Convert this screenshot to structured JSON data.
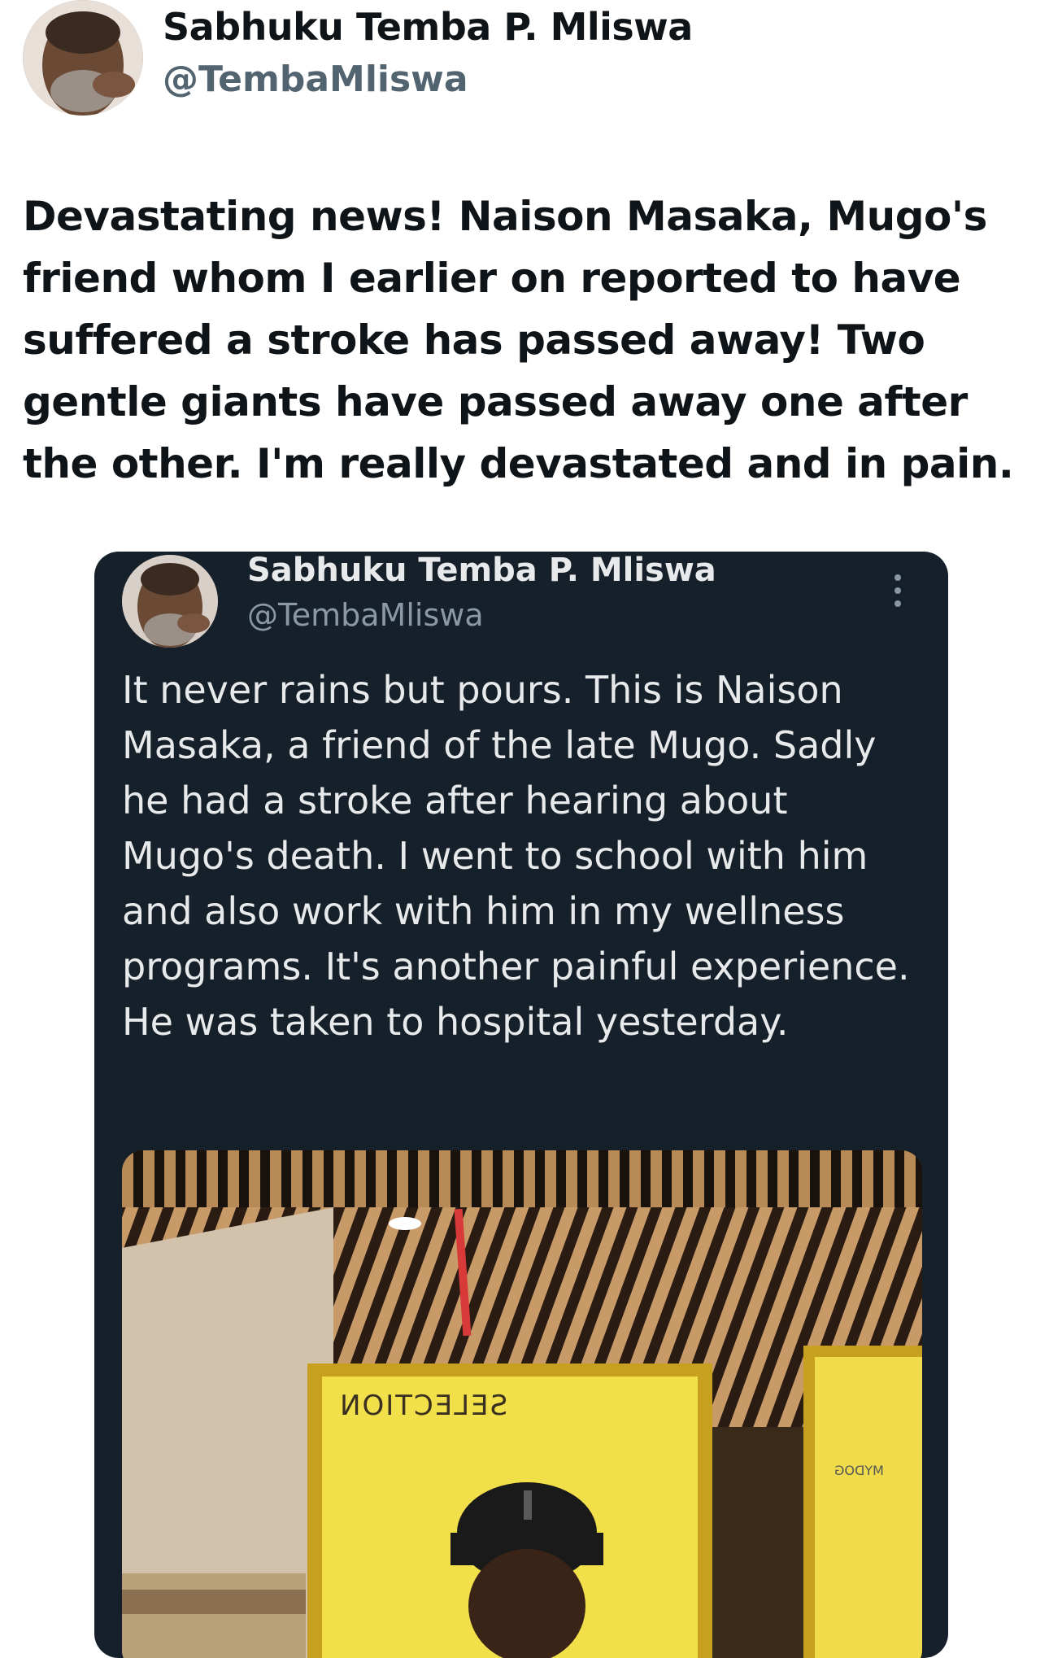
{
  "tweet": {
    "author_name": "Sabhuku Temba P. Mliswa",
    "author_handle": "@TembaMliswa",
    "text": "Devastating news! Naison Masaka, Mugo's friend whom I earlier on reported to have suffered a stroke has passed away! Two gentle giants have passed away one after the other. I'm really devastated and in pain."
  },
  "quoted_tweet": {
    "author_name": "Sabhuku Temba P. Mliswa",
    "author_handle": "@TembaMliswa",
    "text": "It never rains but pours. This is Naison Masaka, a friend of the late Mugo. Sadly he had a stroke after hearing about Mugo's death. I went to school with him and also work with him in my wellness programs. It's another painful experience. He was taken to hospital yesterday.",
    "photo": {
      "sign_text": "SELECTION",
      "brand_text": "MYDOG"
    }
  },
  "icons": {
    "more": "more-vertical-icon"
  }
}
